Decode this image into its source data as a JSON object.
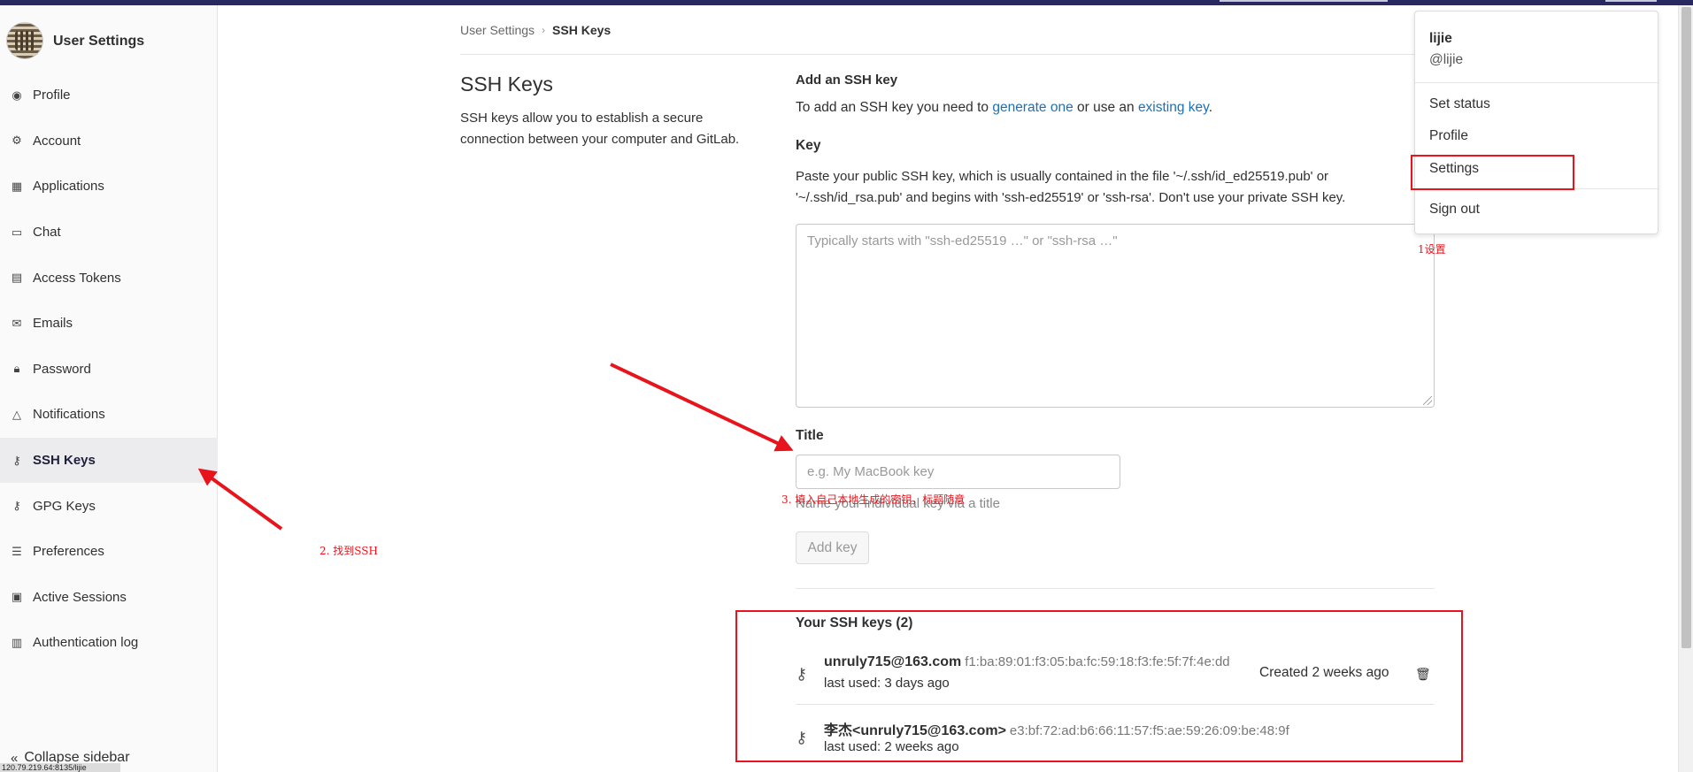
{
  "app": {
    "title": "User Settings"
  },
  "sidebar": {
    "items": [
      {
        "label": "Profile",
        "icon": "profile-icon"
      },
      {
        "label": "Account",
        "icon": "account-icon"
      },
      {
        "label": "Applications",
        "icon": "applications-icon"
      },
      {
        "label": "Chat",
        "icon": "chat-icon"
      },
      {
        "label": "Access Tokens",
        "icon": "token-icon"
      },
      {
        "label": "Emails",
        "icon": "email-icon"
      },
      {
        "label": "Password",
        "icon": "lock-icon"
      },
      {
        "label": "Notifications",
        "icon": "bell-icon"
      },
      {
        "label": "SSH Keys",
        "icon": "key-icon",
        "active": true
      },
      {
        "label": "GPG Keys",
        "icon": "key-icon"
      },
      {
        "label": "Preferences",
        "icon": "preferences-icon"
      },
      {
        "label": "Active Sessions",
        "icon": "monitor-icon"
      },
      {
        "label": "Authentication log",
        "icon": "log-icon"
      }
    ],
    "collapse_label": "Collapse sidebar",
    "status_url": "120.79.219.64:8135/lijie"
  },
  "breadcrumb": {
    "parent": "User Settings",
    "current": "SSH Keys"
  },
  "section": {
    "title": "SSH Keys",
    "description": "SSH keys allow you to establish a secure connection between your computer and GitLab."
  },
  "form": {
    "add_title": "Add an SSH key",
    "add_desc_prefix": "To add an SSH key you need to ",
    "generate_link": "generate one",
    "add_desc_middle": " or use an ",
    "existing_link": "existing key",
    "add_desc_suffix": ".",
    "key_label": "Key",
    "key_help": "Paste your public SSH key, which is usually contained in the file '~/.ssh/id_ed25519.pub' or '~/.ssh/id_rsa.pub' and begins with 'ssh-ed25519' or 'ssh-rsa'. Don't use your private SSH key.",
    "key_placeholder": "Typically starts with \"ssh-ed25519 …\" or \"ssh-rsa …\"",
    "title_label": "Title",
    "title_placeholder": "e.g. My MacBook key",
    "title_help": "Name your individual key via a title",
    "add_button": "Add key"
  },
  "keys": {
    "header": "Your SSH keys (2)",
    "list": [
      {
        "name": "unruly715@163.com",
        "fingerprint": "f1:ba:89:01:f3:05:ba:fc:59:18:f3:fe:5f:7f:4e:dd",
        "last_used": "last used: 3 days ago",
        "created": "Created 2 weeks ago"
      },
      {
        "name": "李杰<unruly715@163.com>",
        "fingerprint": "e3:bf:72:ad:b6:66:11:57:f5:ae:59:26:09:be:48:9f",
        "last_used": "last used: 2 weeks ago",
        "created": ""
      }
    ]
  },
  "user_menu": {
    "name": "lijie",
    "username": "@lijie",
    "items": [
      "Set status",
      "Profile",
      "Settings",
      "Sign out"
    ]
  },
  "annotations": {
    "step1": "1设置",
    "step2": "2. 找到SSH",
    "step3": "3. 填入自己本地生成的密钥，标题随意"
  },
  "colors": {
    "annotation_red": "#e8141b",
    "link_blue": "#1f6fb5",
    "topbar": "#292961"
  }
}
